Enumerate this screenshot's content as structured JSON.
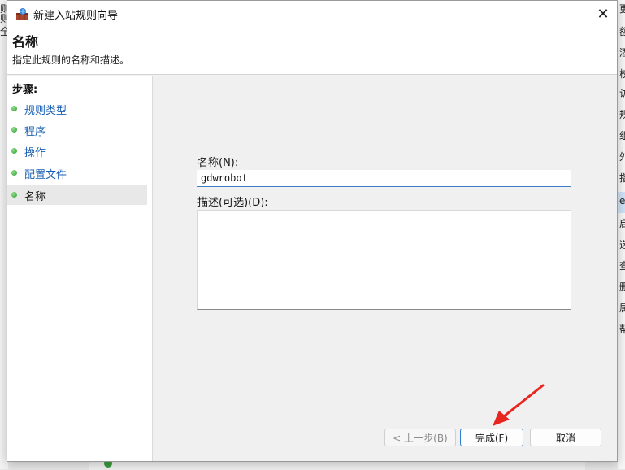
{
  "background": {
    "left_fragments": [
      "则",
      "则",
      "全"
    ],
    "right_fragments": [
      "更",
      "额",
      "酒",
      "校",
      "访",
      "规",
      "组",
      "外",
      "指",
      "e",
      "启",
      "选",
      "查",
      "删",
      "属",
      "帮"
    ]
  },
  "window": {
    "title": "新建入站规则向导",
    "close_glyph": "✕"
  },
  "header": {
    "title": "名称",
    "description": "指定此规则的名称和描述。"
  },
  "steps": {
    "title": "步骤:",
    "items": [
      {
        "label": "规则类型"
      },
      {
        "label": "程序"
      },
      {
        "label": "操作"
      },
      {
        "label": "配置文件"
      },
      {
        "label": "名称"
      }
    ]
  },
  "form": {
    "name_label": "名称(N):",
    "name_value": "gdwrobot",
    "desc_label": "描述(可选)(D):",
    "desc_value": ""
  },
  "buttons": {
    "back": "< 上一步(B)",
    "finish": "完成(F)",
    "cancel": "取消"
  },
  "colors": {
    "link": "#1a5fb4",
    "step_dot": "#2f9a2f",
    "annotation_arrow": "#e8251e",
    "focus_border": "#2f7fd0"
  }
}
